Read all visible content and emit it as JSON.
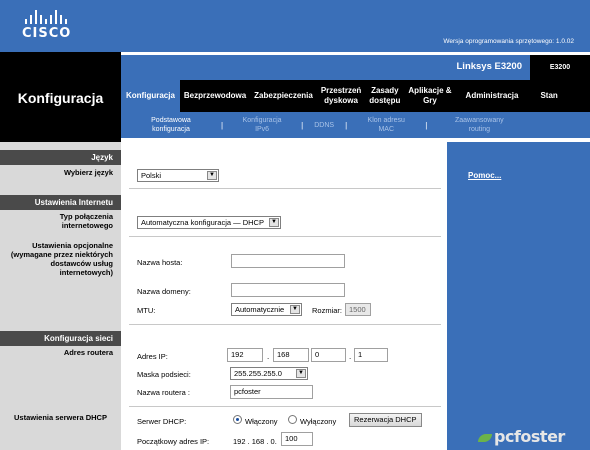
{
  "brand": {
    "name": "CISCO"
  },
  "header": {
    "firmware_version": "Wersja oprogramowania sprzętowego: 1.0.02",
    "product_name": "Linksys E3200",
    "model": "E3200"
  },
  "section_title": "Konfiguracja",
  "tabs": [
    {
      "label": "Konfiguracja",
      "active": true
    },
    {
      "label": "Bezprzewodowa"
    },
    {
      "label": "Zabezpieczenia"
    },
    {
      "label_line1": "Przestrzeń",
      "label_line2": "dyskowa"
    },
    {
      "label_line1": "Zasady",
      "label_line2": "dostępu"
    },
    {
      "label_line1": "Aplikacje &",
      "label_line2": "Gry"
    },
    {
      "label": "Administracja"
    },
    {
      "label": "Stan"
    }
  ],
  "subtabs": [
    {
      "line1": "Podstawowa",
      "line2": "konfiguracja",
      "active": true
    },
    {
      "line1": "Konfiguracja",
      "line2": "IPv6"
    },
    {
      "line1": "DDNS"
    },
    {
      "line1": "Klon adresu",
      "line2": "MAC"
    },
    {
      "line1": "Zaawansowany",
      "line2": "routing"
    }
  ],
  "left": {
    "language_header": "Język",
    "choose_language": "Wybierz język",
    "internet_header": "Ustawienia Internetu",
    "connection_type": "Typ połączenia internetowego",
    "optional_settings": "Ustawienia opcjonalne (wymagane przez niektórych dostawców usług internetowych)",
    "network_header": "Konfiguracja sieci",
    "router_address": "Adres routera",
    "dhcp_settings": "Ustawienia serwera DHCP"
  },
  "form": {
    "language_value": "Polski",
    "connection_value": "Automatyczna konfiguracja — DHCP",
    "host_name_label": "Nazwa hosta:",
    "host_name_value": "",
    "domain_name_label": "Nazwa domeny:",
    "domain_name_value": "",
    "mtu_label": "MTU:",
    "mtu_value": "Automatycznie",
    "size_label": "Rozmiar:",
    "size_value": "1500",
    "ip_label": "Adres IP:",
    "ip": [
      "192",
      "168",
      "0",
      "1"
    ],
    "mask_label": "Maska podsieci:",
    "mask_value": "255.255.255.0",
    "router_name_label": "Nazwa routera :",
    "router_name_value": "pcfoster",
    "dhcp_label": "Serwer DHCP:",
    "dhcp_on": "Włączony",
    "dhcp_off": "Wyłączony",
    "dhcp_reservation_button": "Rezerwacja DHCP",
    "start_ip_label": "Początkowy adres IP:",
    "start_ip_prefix": "192 . 168 . 0.",
    "start_ip_value": "100"
  },
  "help": {
    "link": "Pomoc..."
  },
  "watermark": "pcfoster"
}
